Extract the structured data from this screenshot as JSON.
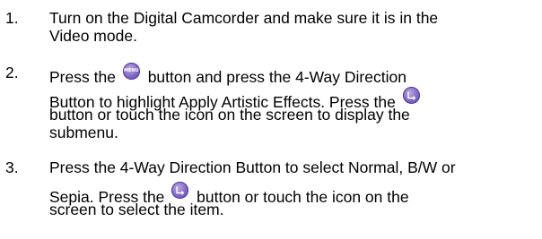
{
  "steps": [
    {
      "number": "1.",
      "lines": [
        "Turn on the Digital Camcorder and make sure it is in the",
        "Video mode."
      ]
    },
    {
      "number": "2.",
      "line1_before": "Press the",
      "menu_icon_text": "MENU",
      "line1_after": "button and press the 4-Way Direction",
      "line2_before": "Button to highlight Apply Artistic Effects. Press the",
      "line3": "button or touch the icon on the screen to display the",
      "line4": "submenu."
    },
    {
      "number": "3.",
      "line1": "Press the 4-Way Direction Button to select Normal, B/W or",
      "line2_before": "Sepia. Press the",
      "line2_after": "button or touch the icon on the",
      "line3": "screen to select the item."
    }
  ],
  "icons": {
    "menu": "menu-button-icon",
    "ok": "ok-enter-button-icon"
  },
  "colors": {
    "icon_fill": "#7f66c4",
    "text": "#000000"
  }
}
